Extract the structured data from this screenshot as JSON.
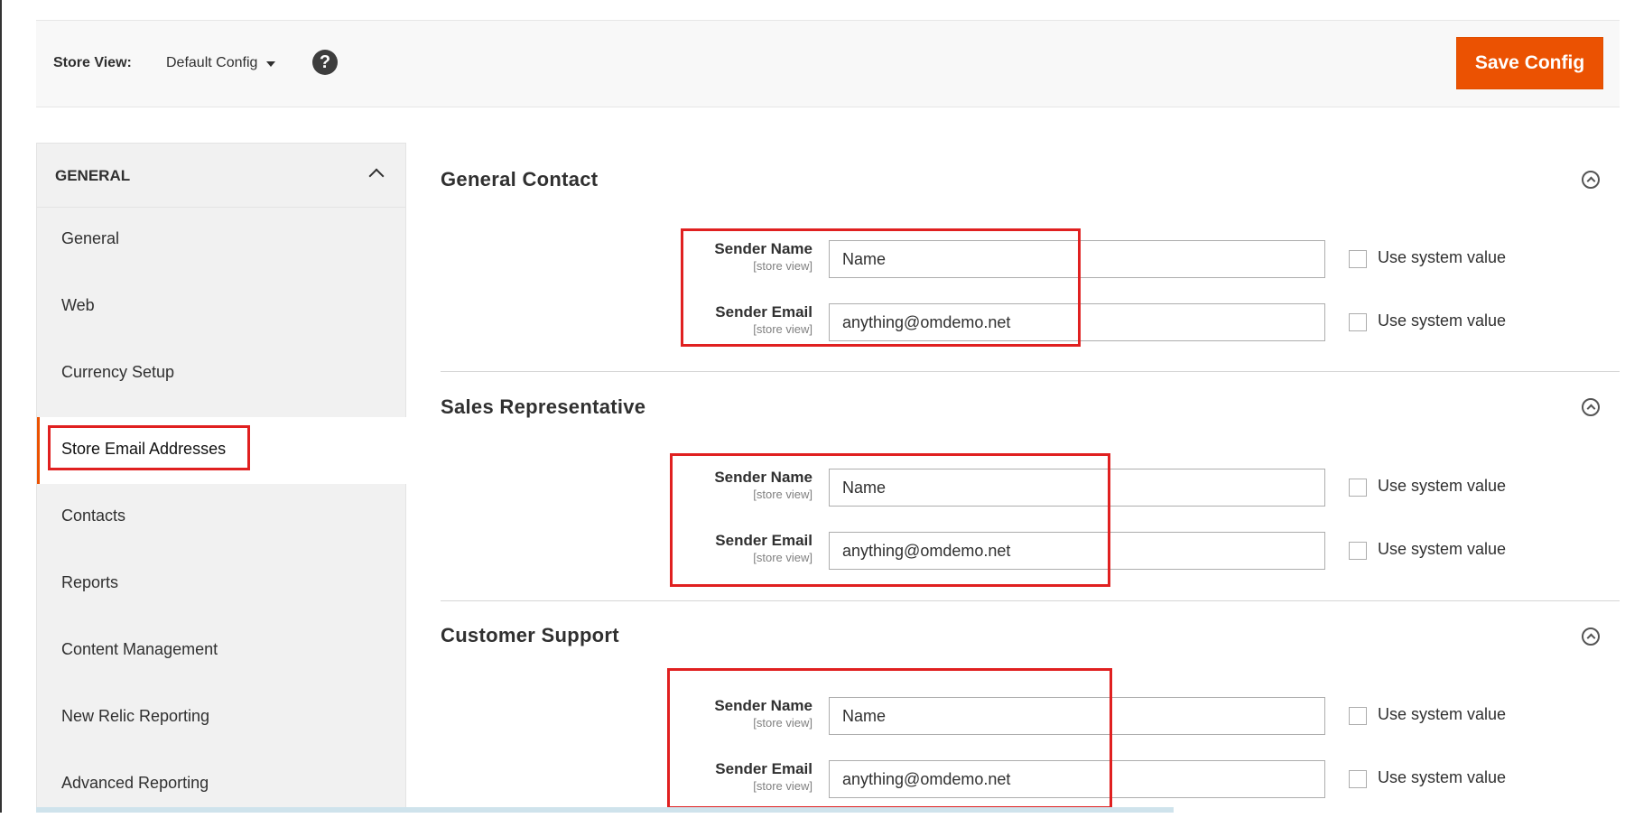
{
  "header": {
    "store_view_label": "Store View:",
    "store_view_value": "Default Config",
    "help_icon": "question-circle-icon",
    "save_button": "Save Config"
  },
  "sidebar": {
    "title": "GENERAL",
    "items": [
      {
        "label": "General"
      },
      {
        "label": "Web"
      },
      {
        "label": "Currency Setup"
      },
      {
        "label": "Store Email Addresses",
        "active": true
      },
      {
        "label": "Contacts"
      },
      {
        "label": "Reports"
      },
      {
        "label": "Content Management"
      },
      {
        "label": "New Relic Reporting"
      },
      {
        "label": "Advanced Reporting"
      }
    ]
  },
  "sections": [
    {
      "title": "General Contact",
      "fields": [
        {
          "label": "Sender Name",
          "scope": "[store view]",
          "value": "Name",
          "checkbox_label": "Use system value",
          "checked": false
        },
        {
          "label": "Sender Email",
          "scope": "[store view]",
          "value": "anything@omdemo.net",
          "checkbox_label": "Use system value",
          "checked": false
        }
      ]
    },
    {
      "title": "Sales Representative",
      "fields": [
        {
          "label": "Sender Name",
          "scope": "[store view]",
          "value": "Name",
          "checkbox_label": "Use system value",
          "checked": false
        },
        {
          "label": "Sender Email",
          "scope": "[store view]",
          "value": "anything@omdemo.net",
          "checkbox_label": "Use system value",
          "checked": false
        }
      ]
    },
    {
      "title": "Customer Support",
      "fields": [
        {
          "label": "Sender Name",
          "scope": "[store view]",
          "value": "Name",
          "checkbox_label": "Use system value",
          "checked": false
        },
        {
          "label": "Sender Email",
          "scope": "[store view]",
          "value": "anything@omdemo.net",
          "checkbox_label": "Use system value",
          "checked": false
        }
      ]
    }
  ],
  "colors": {
    "accent": "#eb5202",
    "highlight": "#e02020"
  }
}
